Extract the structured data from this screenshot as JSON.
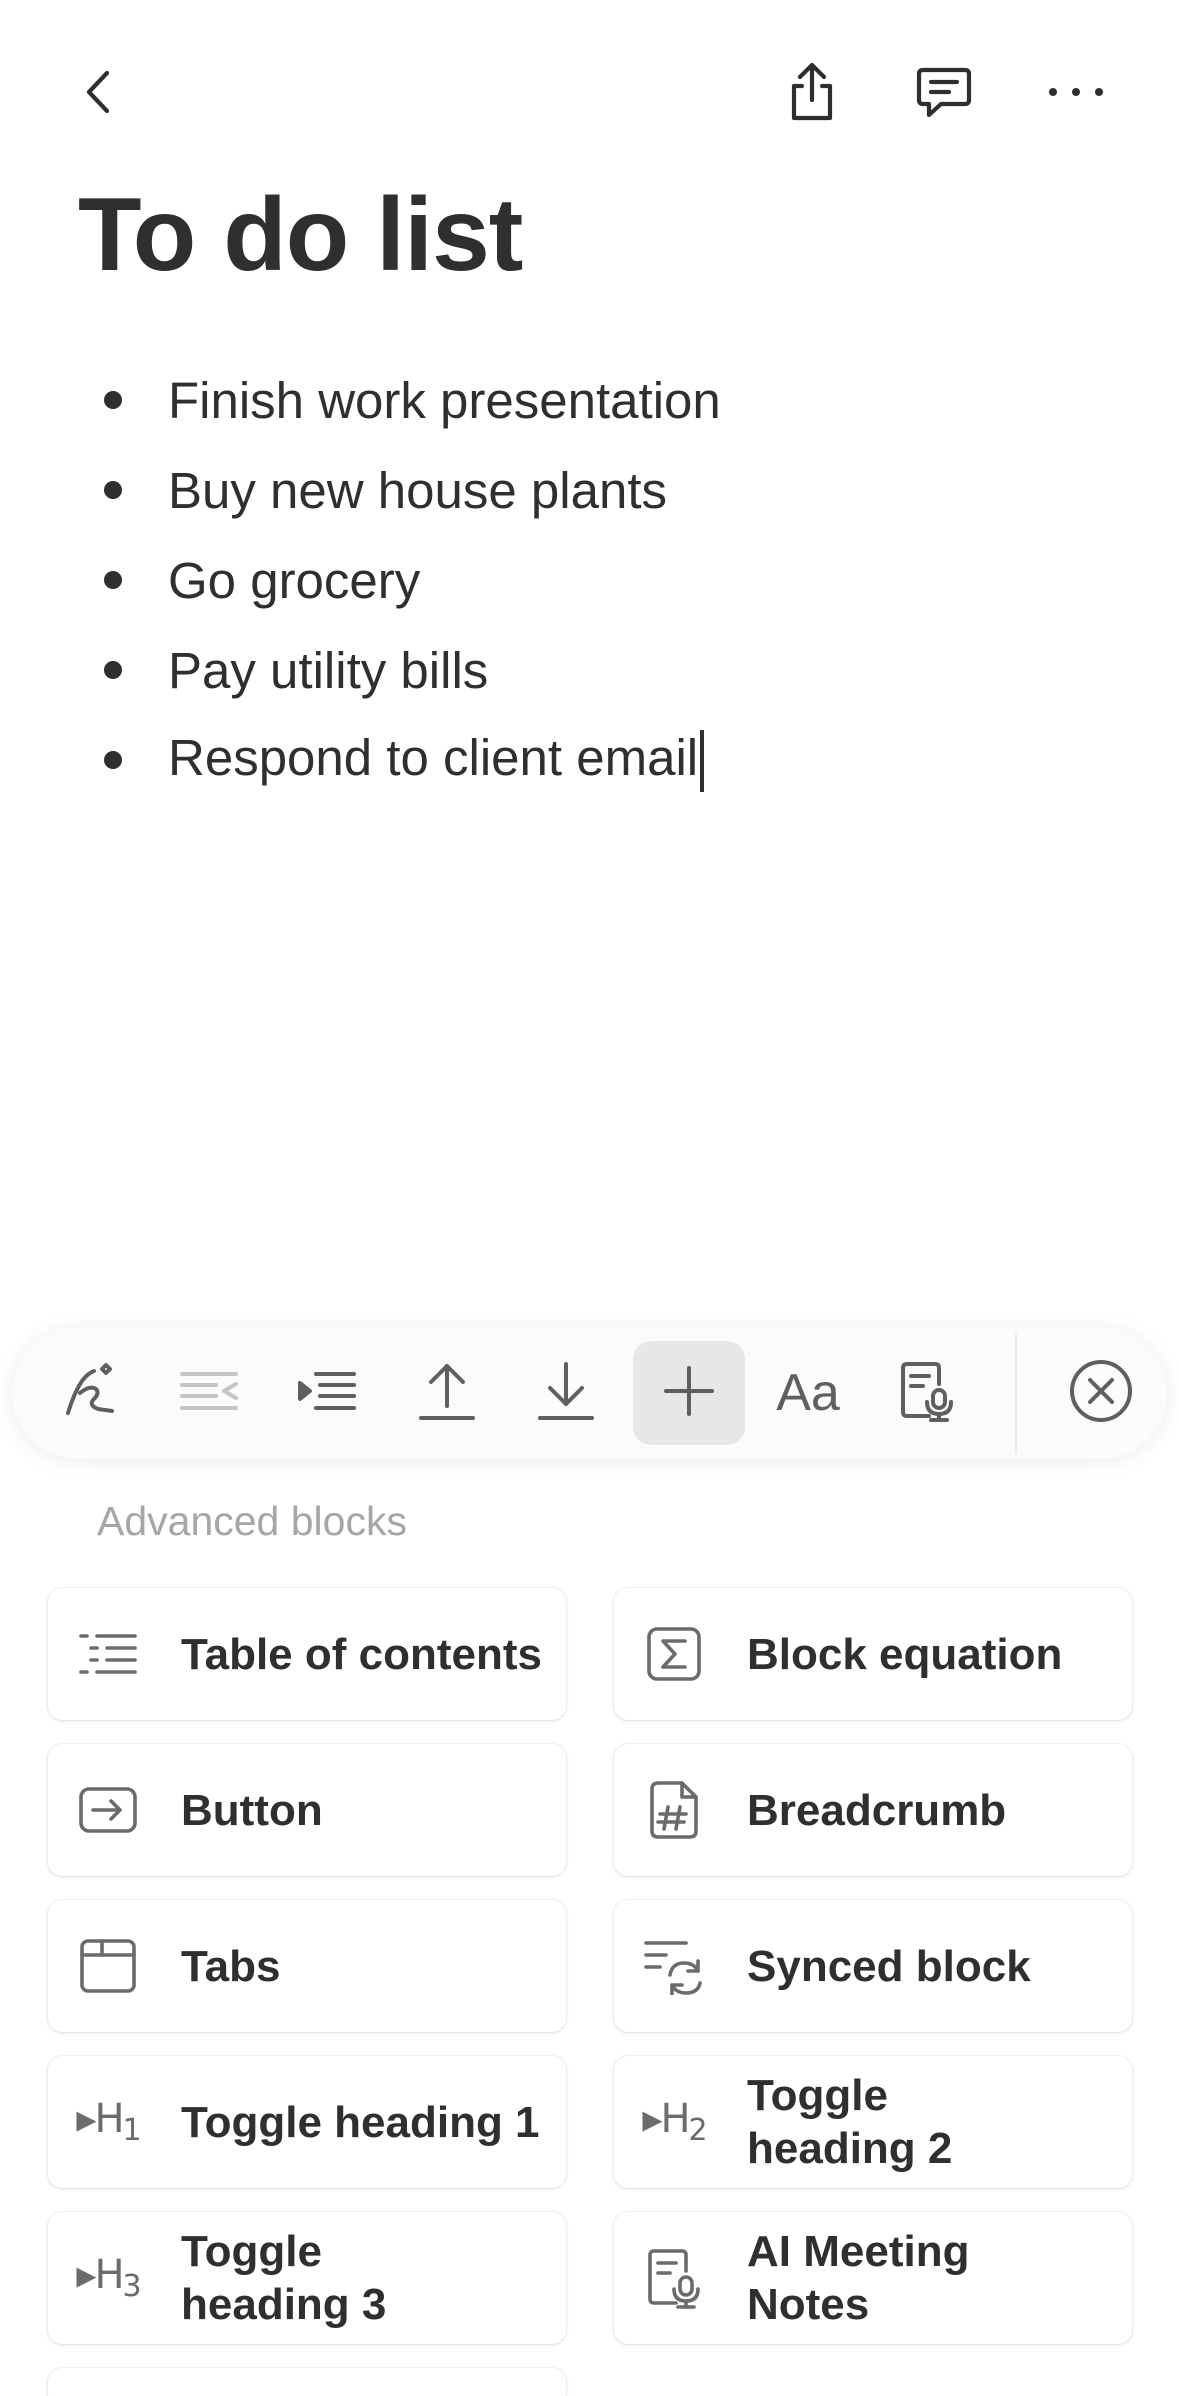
{
  "header": {
    "back_icon": "chevron-left-icon",
    "share_icon": "share-icon",
    "comment_icon": "comment-icon",
    "more_icon": "more-horizontal-icon"
  },
  "page": {
    "title": "To do list",
    "items": [
      "Finish work presentation",
      "Buy new house plants",
      "Go grocery",
      "Pay utility bills",
      "Respond to client email"
    ]
  },
  "toolbar": {
    "tools": [
      "ai-pen-icon",
      "outdent-icon",
      "indent-icon",
      "move-up-icon",
      "move-down-icon",
      "add-block-icon",
      "text-style-icon",
      "ai-meeting-notes-icon",
      "close-keyboard-icon"
    ],
    "text_style_label": "Aa"
  },
  "blocks": {
    "section_label": "Advanced blocks",
    "items": [
      {
        "label": "Table of contents",
        "icon": "table-of-contents-icon"
      },
      {
        "label": "Block equation",
        "icon": "equation-icon"
      },
      {
        "label": "Button",
        "icon": "button-icon"
      },
      {
        "label": "Breadcrumb",
        "icon": "breadcrumb-icon"
      },
      {
        "label": "Tabs",
        "icon": "tabs-icon"
      },
      {
        "label": "Synced block",
        "icon": "synced-block-icon"
      },
      {
        "label": "Toggle heading 1",
        "icon": "toggle-heading-1-icon",
        "glyph": "H",
        "sub": "1"
      },
      {
        "label": "Toggle heading 2",
        "icon": "toggle-heading-2-icon",
        "glyph": "H",
        "sub": "2"
      },
      {
        "label": "Toggle heading 3",
        "icon": "toggle-heading-3-icon",
        "glyph": "H",
        "sub": "3"
      },
      {
        "label": "AI Meeting Notes",
        "icon": "ai-meeting-notes-icon"
      }
    ]
  },
  "colors": {
    "text": "#2f2f2f",
    "muted": "#a6a6a6",
    "icon": "#6b6b6b",
    "selected_tool_bg": "#e7e7e7"
  }
}
